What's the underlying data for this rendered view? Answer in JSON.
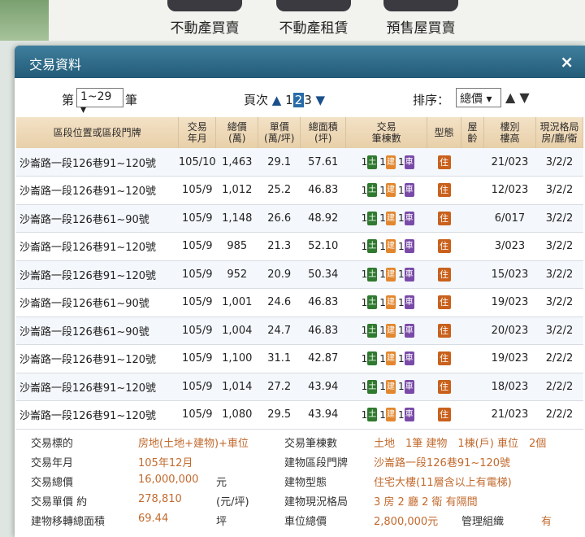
{
  "nav": {
    "buttons": [
      "不動產買賣",
      "不動產租賃",
      "預售屋買賣"
    ]
  },
  "modal": {
    "title": "交易資料",
    "close": "×"
  },
  "controls": {
    "prefix": "第",
    "range": "1~29 ▾",
    "suffix": "筆",
    "pages_label": "頁次",
    "page_prev_arrow": "▲",
    "pages": [
      "1",
      "2",
      "3"
    ],
    "current_page": "2",
    "page_next_arrow": "▼",
    "sort_label": "排序：",
    "sort_value": "總價 ▾",
    "sort_asc": "▲",
    "sort_desc": "▼"
  },
  "table": {
    "headers": [
      "區段位置或區段門牌",
      "交易\n年月",
      "總價\n(萬)",
      "單價\n(萬/坪)",
      "總面積\n(坪)",
      "交易\n筆棟數",
      "型態",
      "屋\n齡",
      "樓別\n樓高",
      "現況格局\n房/廳/衛"
    ],
    "badges": {
      "land": "土",
      "build": "建",
      "car": "車",
      "type": "住"
    },
    "rows": [
      {
        "loc": "沙崙路一段126巷91~120號",
        "date": "105/10",
        "total": "1,463",
        "unit": "29.1",
        "area": "57.61",
        "land": "1",
        "build": "1",
        "car": "1",
        "age": "",
        "floor": "21/023",
        "layout": "3/2/2"
      },
      {
        "loc": "沙崙路一段126巷91~120號",
        "date": "105/9",
        "total": "1,012",
        "unit": "25.2",
        "area": "46.83",
        "land": "1",
        "build": "1",
        "car": "1",
        "age": "",
        "floor": "12/023",
        "layout": "3/2/2"
      },
      {
        "loc": "沙崙路一段126巷61~90號",
        "date": "105/9",
        "total": "1,148",
        "unit": "26.6",
        "area": "48.92",
        "land": "1",
        "build": "1",
        "car": "1",
        "age": "",
        "floor": "6/017",
        "layout": "3/2/2"
      },
      {
        "loc": "沙崙路一段126巷91~120號",
        "date": "105/9",
        "total": "985",
        "unit": "21.3",
        "area": "52.10",
        "land": "1",
        "build": "1",
        "car": "1",
        "age": "",
        "floor": "3/023",
        "layout": "3/2/2"
      },
      {
        "loc": "沙崙路一段126巷91~120號",
        "date": "105/9",
        "total": "952",
        "unit": "20.9",
        "area": "50.34",
        "land": "1",
        "build": "1",
        "car": "1",
        "age": "",
        "floor": "15/023",
        "layout": "3/2/2"
      },
      {
        "loc": "沙崙路一段126巷61~90號",
        "date": "105/9",
        "total": "1,001",
        "unit": "24.6",
        "area": "46.83",
        "land": "1",
        "build": "1",
        "car": "1",
        "age": "",
        "floor": "19/023",
        "layout": "3/2/2"
      },
      {
        "loc": "沙崙路一段126巷61~90號",
        "date": "105/9",
        "total": "1,004",
        "unit": "24.7",
        "area": "46.83",
        "land": "1",
        "build": "1",
        "car": "1",
        "age": "",
        "floor": "20/023",
        "layout": "3/2/2"
      },
      {
        "loc": "沙崙路一段126巷91~120號",
        "date": "105/9",
        "total": "1,100",
        "unit": "31.1",
        "area": "42.87",
        "land": "1",
        "build": "1",
        "car": "1",
        "age": "",
        "floor": "19/023",
        "layout": "2/2/2"
      },
      {
        "loc": "沙崙路一段126巷91~120號",
        "date": "105/9",
        "total": "1,014",
        "unit": "27.2",
        "area": "43.94",
        "land": "1",
        "build": "1",
        "car": "1",
        "age": "",
        "floor": "18/023",
        "layout": "2/2/2"
      },
      {
        "loc": "沙崙路一段126巷91~120號",
        "date": "105/9",
        "total": "1,080",
        "unit": "29.5",
        "area": "43.94",
        "land": "1",
        "build": "1",
        "car": "1",
        "age": "",
        "floor": "21/023",
        "layout": "2/2/2"
      }
    ]
  },
  "details": {
    "left": [
      {
        "label": "交易標的",
        "value": "房地(土地+建物)+車位",
        "unit": ""
      },
      {
        "label": "交易年月",
        "value": "105年12月",
        "unit": ""
      },
      {
        "label": "交易總價",
        "value": "16,000,000",
        "unit": "元"
      },
      {
        "label": "交易單價 約",
        "value": "278,810",
        "unit": "(元/坪)"
      },
      {
        "label": "建物移轉總面積",
        "value": "69.44",
        "unit": "坪"
      }
    ],
    "right": [
      {
        "label": "交易筆棟數",
        "value": "土地　1筆 建物　1棟(戶) 車位　2個",
        "unit": ""
      },
      {
        "label": "建物區段門牌",
        "value": "沙崙路一段126巷91~120號",
        "unit": ""
      },
      {
        "label": "建物型態",
        "value": "住宅大樓(11層含以上有電梯)",
        "unit": ""
      },
      {
        "label": "建物現況格局",
        "value": "3 房 2 廳 2 衛 有隔間",
        "unit": ""
      },
      {
        "label": "車位總價",
        "value": "2,800,000元",
        "unit": ""
      }
    ],
    "management": {
      "label": "管理組織",
      "value": "有"
    }
  }
}
